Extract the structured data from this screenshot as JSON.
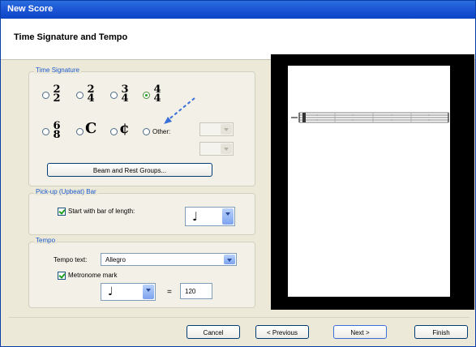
{
  "window": {
    "title": "New Score"
  },
  "header": {
    "title": "Time Signature and Tempo"
  },
  "time_signature": {
    "legend": "Time Signature",
    "options": [
      {
        "top": "2",
        "bottom": "2",
        "selected": false
      },
      {
        "top": "2",
        "bottom": "4",
        "selected": false
      },
      {
        "top": "3",
        "bottom": "4",
        "selected": false
      },
      {
        "top": "4",
        "bottom": "4",
        "selected": true
      },
      {
        "top": "6",
        "bottom": "8",
        "selected": false
      }
    ],
    "common_time": "C",
    "cut_time": "¢",
    "other_label": "Other:",
    "beam_button": "Beam and Rest Groups..."
  },
  "pickup": {
    "legend": "Pick-up (Upbeat) Bar",
    "checkbox_label": "Start with bar of length:",
    "checked": true,
    "note": "♩"
  },
  "tempo": {
    "legend": "Tempo",
    "text_label": "Tempo text:",
    "text_value": "Allegro",
    "metronome_label": "Metronome mark",
    "metronome_checked": true,
    "note": "♩",
    "equals": "=",
    "bpm": "120"
  },
  "buttons": {
    "cancel": "Cancel",
    "previous": "< Previous",
    "next": "Next >",
    "finish": "Finish"
  }
}
